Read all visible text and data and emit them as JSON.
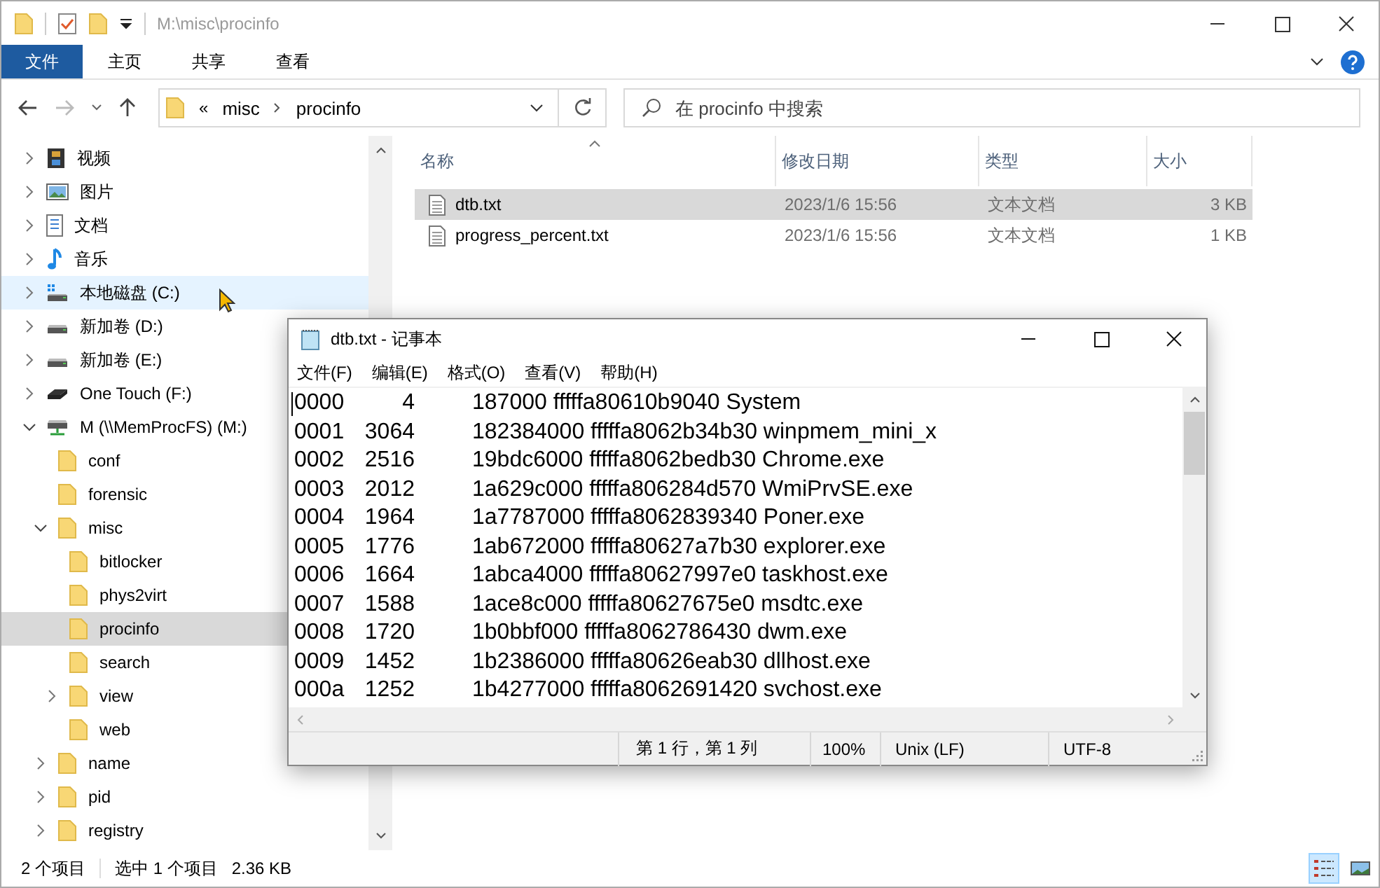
{
  "window": {
    "title": "M:\\misc\\procinfo"
  },
  "ribbon_tabs": [
    {
      "label": "文件",
      "selected": true
    },
    {
      "label": "主页",
      "selected": false
    },
    {
      "label": "共享",
      "selected": false
    },
    {
      "label": "查看",
      "selected": false
    }
  ],
  "address_bar": {
    "overflow": "«",
    "segments": [
      "misc",
      "procinfo"
    ]
  },
  "search": {
    "placeholder": "在 procinfo 中搜索"
  },
  "sidebar": {
    "items": [
      {
        "label": "视频",
        "kind": "video",
        "expanded": false,
        "selected": false,
        "hovered": false
      },
      {
        "label": "图片",
        "kind": "pictures",
        "expanded": false,
        "selected": false,
        "hovered": false
      },
      {
        "label": "文档",
        "kind": "documents",
        "expanded": false,
        "selected": false,
        "hovered": false
      },
      {
        "label": "音乐",
        "kind": "music",
        "expanded": false,
        "selected": false,
        "hovered": false
      },
      {
        "label": "本地磁盘 (C:)",
        "kind": "system-drive",
        "expanded": false,
        "selected": false,
        "hovered": true
      },
      {
        "label": "新加卷 (D:)",
        "kind": "drive",
        "expanded": false,
        "selected": false,
        "hovered": false
      },
      {
        "label": "新加卷 (E:)",
        "kind": "drive",
        "expanded": false,
        "selected": false,
        "hovered": false
      },
      {
        "label": "One Touch (F:)",
        "kind": "external-drive",
        "expanded": false,
        "selected": false,
        "hovered": false
      },
      {
        "label": "M (\\\\MemProcFS) (M:)",
        "kind": "network-drive",
        "expanded": true,
        "selected": false,
        "hovered": false,
        "children": [
          {
            "label": "conf",
            "kind": "folder",
            "selected": false,
            "hovered": false
          },
          {
            "label": "forensic",
            "kind": "folder",
            "selected": false,
            "hovered": false
          },
          {
            "label": "misc",
            "kind": "folder",
            "expanded": true,
            "selected": false,
            "hovered": false,
            "children": [
              {
                "label": "bitlocker",
                "kind": "folder",
                "selected": false,
                "hovered": false
              },
              {
                "label": "phys2virt",
                "kind": "folder",
                "selected": false,
                "hovered": false
              },
              {
                "label": "procinfo",
                "kind": "folder",
                "selected": true,
                "hovered": false
              },
              {
                "label": "search",
                "kind": "folder",
                "selected": false,
                "hovered": false
              },
              {
                "label": "view",
                "kind": "folder",
                "expanded": false,
                "selected": false,
                "hovered": false
              },
              {
                "label": "web",
                "kind": "folder",
                "selected": false,
                "hovered": false
              }
            ]
          },
          {
            "label": "name",
            "kind": "folder",
            "expanded": false,
            "selected": false,
            "hovered": false
          },
          {
            "label": "pid",
            "kind": "folder",
            "expanded": false,
            "selected": false,
            "hovered": false
          },
          {
            "label": "registry",
            "kind": "folder",
            "expanded": false,
            "selected": false,
            "hovered": false
          }
        ]
      }
    ]
  },
  "file_list": {
    "columns": [
      "名称",
      "修改日期",
      "类型",
      "大小"
    ],
    "rows": [
      {
        "name": "dtb.txt",
        "modified": "2023/1/6 15:56",
        "type": "文本文档",
        "size": "3 KB",
        "selected": true
      },
      {
        "name": "progress_percent.txt",
        "modified": "2023/1/6 15:56",
        "type": "文本文档",
        "size": "1 KB",
        "selected": false
      }
    ]
  },
  "status_bar": {
    "count": "2 个项目",
    "selection": "选中 1 个项目",
    "selection_size": "2.36 KB",
    "views": [
      {
        "kind": "details",
        "selected": true
      },
      {
        "kind": "large-icons",
        "selected": false
      }
    ]
  },
  "notepad": {
    "title": "dtb.txt - 记事本",
    "menu": [
      "文件(F)",
      "编辑(E)",
      "格式(O)",
      "查看(V)",
      "帮助(H)"
    ],
    "lines": [
      {
        "index": "0000",
        "pid": "4",
        "rest": "187000 fffffa80610b9040 System"
      },
      {
        "index": "0001",
        "pid": "3064",
        "rest": "182384000 fffffa8062b34b30 winpmem_mini_x"
      },
      {
        "index": "0002",
        "pid": "2516",
        "rest": "19bdc6000 fffffa8062bedb30 Chrome.exe"
      },
      {
        "index": "0003",
        "pid": "2012",
        "rest": "1a629c000 fffffa806284d570 WmiPrvSE.exe"
      },
      {
        "index": "0004",
        "pid": "1964",
        "rest": "1a7787000 fffffa8062839340 Poner.exe"
      },
      {
        "index": "0005",
        "pid": "1776",
        "rest": "1ab672000 fffffa80627a7b30 explorer.exe"
      },
      {
        "index": "0006",
        "pid": "1664",
        "rest": "1abca4000 fffffa80627997e0 taskhost.exe"
      },
      {
        "index": "0007",
        "pid": "1588",
        "rest": "1ace8c000 fffffa80627675e0 msdtc.exe"
      },
      {
        "index": "0008",
        "pid": "1720",
        "rest": "1b0bbf000 fffffa8062786430 dwm.exe"
      },
      {
        "index": "0009",
        "pid": "1452",
        "rest": "1b2386000 fffffa80626eab30 dllhost.exe"
      },
      {
        "index": "000a",
        "pid": "1252",
        "rest": "1b4277000 fffffa8062691420 svchost.exe"
      }
    ],
    "status": {
      "position": "第 1 行，第 1 列",
      "zoom": "100%",
      "line_ending": "Unix (LF)",
      "encoding": "UTF-8"
    }
  }
}
